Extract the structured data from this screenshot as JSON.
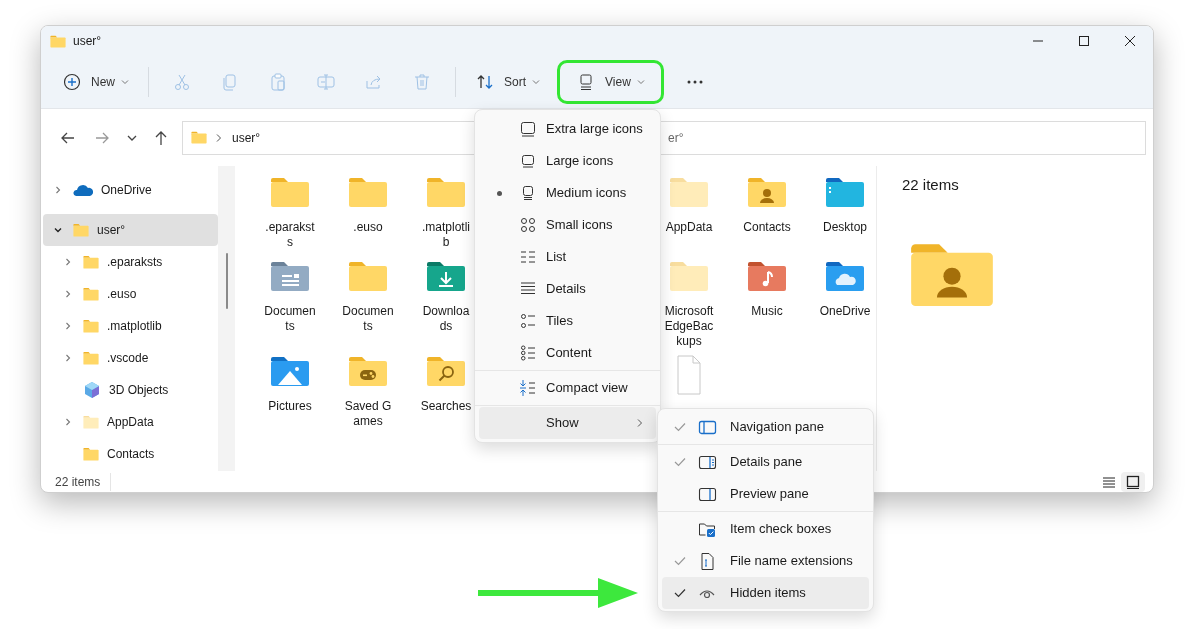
{
  "window": {
    "title": "user°"
  },
  "toolbar": [
    {
      "kind": "new",
      "label": "New",
      "disabled": false,
      "annotated": false
    },
    {
      "kind": "cut",
      "disabled": true,
      "annotated": false
    },
    {
      "kind": "copy",
      "disabled": true,
      "annotated": false
    },
    {
      "kind": "paste",
      "disabled": true,
      "annotated": false
    },
    {
      "kind": "rename",
      "disabled": true,
      "annotated": false
    },
    {
      "kind": "share",
      "disabled": true,
      "annotated": false
    },
    {
      "kind": "delete",
      "disabled": true,
      "annotated": false
    },
    {
      "kind": "sort",
      "label": "Sort",
      "disabled": false,
      "annotated": false
    },
    {
      "kind": "view",
      "label": "View",
      "disabled": false,
      "annotated": true
    },
    {
      "kind": "more",
      "disabled": false,
      "annotated": false
    }
  ],
  "address_bar": {
    "path": [
      "user°"
    ],
    "search_fragment": "er°"
  },
  "sidebar": {
    "items": [
      {
        "label": "OneDrive",
        "kind": "onedrive",
        "expanded": false,
        "has_children": true,
        "selected": false
      },
      {
        "label": "user°",
        "kind": "folder",
        "expanded": true,
        "has_children": true,
        "selected": true,
        "children": [
          {
            "label": ".eparaksts",
            "kind": "folder",
            "expanded": false,
            "has_children": true,
            "selected": false
          },
          {
            "label": ".euso",
            "kind": "folder",
            "expanded": false,
            "has_children": true,
            "selected": false
          },
          {
            "label": ".matplotlib",
            "kind": "folder",
            "expanded": false,
            "has_children": true,
            "selected": false
          },
          {
            "label": ".vscode",
            "kind": "folder",
            "expanded": false,
            "has_children": true,
            "selected": false
          },
          {
            "label": "3D Objects",
            "kind": "cube",
            "expanded": false,
            "has_children": false,
            "selected": false
          },
          {
            "label": "AppData",
            "kind": "hidden",
            "expanded": false,
            "has_children": true,
            "selected": false
          },
          {
            "label": "Contacts",
            "kind": "folder",
            "expanded": false,
            "has_children": false,
            "selected": false
          }
        ]
      }
    ]
  },
  "files": {
    "rows": [
      {
        "left": [
          {
            "label": ".eparaksts",
            "kind": "folder"
          },
          {
            "label": ".euso",
            "kind": "folder"
          },
          {
            "label": ".matplotlib",
            "kind": "folder"
          }
        ],
        "right": [
          {
            "label": "AppData",
            "kind": "hidden"
          },
          {
            "label": "Contacts",
            "kind": "contacts"
          },
          {
            "label": "Desktop",
            "kind": "desktop"
          }
        ]
      },
      {
        "left": [
          {
            "label": "Documents",
            "kind": "documents"
          },
          {
            "label": "Documents",
            "kind": "folder"
          },
          {
            "label": "Downloads",
            "kind": "downloads"
          }
        ],
        "right": [
          {
            "label": "MicrosoftEdgeBackups",
            "kind": "hidden"
          },
          {
            "label": "Music",
            "kind": "music"
          },
          {
            "label": "OneDrive",
            "kind": "onedrive"
          }
        ]
      },
      {
        "left": [
          {
            "label": "Pictures",
            "kind": "pictures"
          },
          {
            "label": "Saved Games",
            "kind": "games"
          },
          {
            "label": "Searches",
            "kind": "searches"
          }
        ],
        "right": [
          {
            "kind": "file"
          }
        ]
      }
    ]
  },
  "details_pane": {
    "summary": "22 items",
    "kind": "contacts"
  },
  "status_bar": {
    "count": "22 items",
    "views": [
      {
        "kind": "details",
        "selected": false
      },
      {
        "kind": "large",
        "selected": true
      }
    ]
  },
  "view_menu": {
    "sections": [
      [
        {
          "label": "Extra large icons",
          "kind": "xl",
          "selected": false
        },
        {
          "label": "Large icons",
          "kind": "large",
          "selected": false
        },
        {
          "label": "Medium icons",
          "kind": "medium",
          "selected": true
        },
        {
          "label": "Small icons",
          "kind": "small",
          "selected": false
        },
        {
          "label": "List",
          "kind": "list",
          "selected": false
        },
        {
          "label": "Details",
          "kind": "details",
          "selected": false
        },
        {
          "label": "Tiles",
          "kind": "tiles",
          "selected": false
        },
        {
          "label": "Content",
          "kind": "content",
          "selected": false
        }
      ],
      [
        {
          "label": "Compact view",
          "kind": "compact",
          "selected": false
        }
      ],
      [
        {
          "label": "Show",
          "kind": "submenu",
          "selected": false
        }
      ]
    ]
  },
  "show_menu": {
    "expanded": true,
    "sections": [
      [
        {
          "label": "Navigation pane",
          "kind": "navpane",
          "checked": true,
          "highlighted": false,
          "annotated": false
        }
      ],
      [
        {
          "label": "Details pane",
          "kind": "detailspane",
          "checked": true,
          "highlighted": false,
          "annotated": false
        },
        {
          "label": "Preview pane",
          "kind": "previewpane",
          "checked": false,
          "highlighted": false,
          "annotated": false
        }
      ],
      [
        {
          "label": "Item check boxes",
          "kind": "checkboxes",
          "checked": false,
          "highlighted": false,
          "annotated": false
        },
        {
          "label": "File name extensions",
          "kind": "extensions",
          "checked": true,
          "highlighted": false,
          "annotated": false
        },
        {
          "label": "Hidden items",
          "kind": "eye",
          "checked": true,
          "highlighted": true,
          "annotated": true
        }
      ]
    ]
  }
}
